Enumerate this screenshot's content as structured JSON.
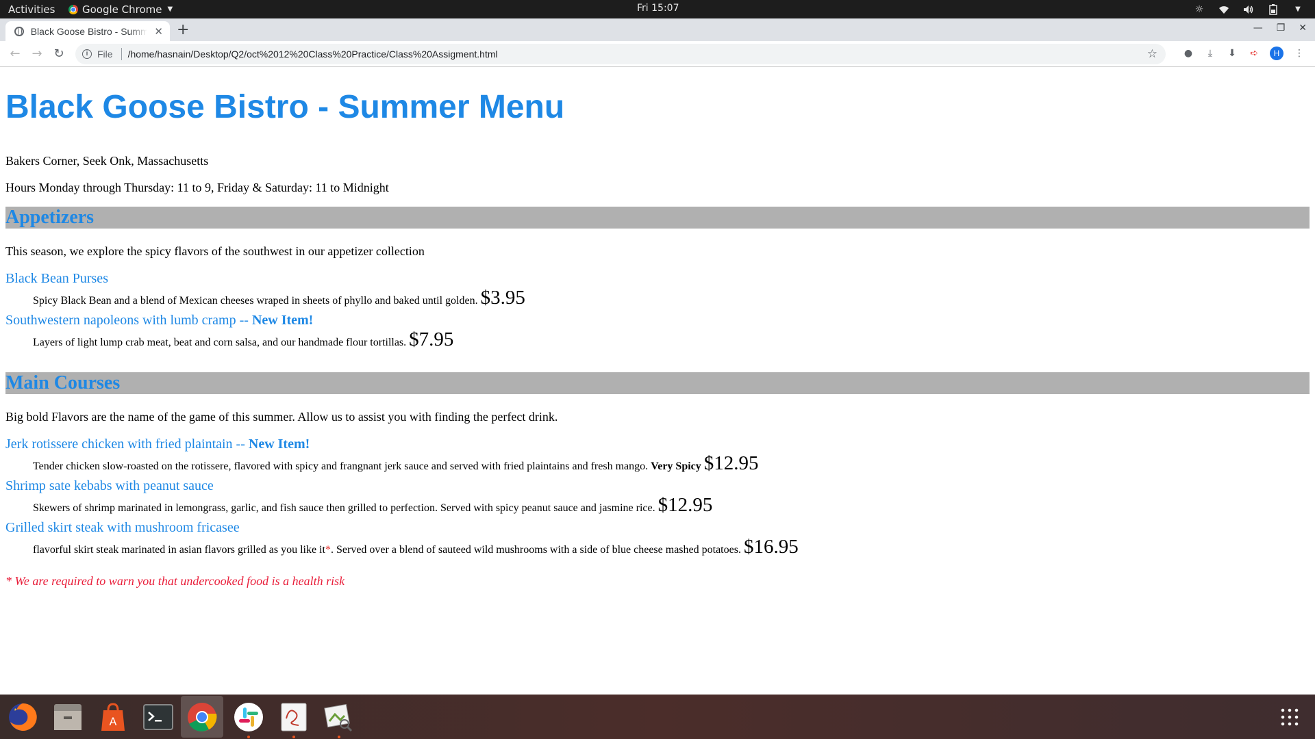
{
  "topbar": {
    "activities": "Activities",
    "app_name": "Google Chrome",
    "clock": "Fri 15:07"
  },
  "browser": {
    "tab_title": "Black Goose Bistro - Summer Menu",
    "url_scheme": "File",
    "url": "/home/hasnain/Desktop/Q2/oct%2012%20Class%20Practice/Class%20Assigment.html",
    "profile_initial": "H"
  },
  "page": {
    "title": "Black Goose Bistro - Summer Menu",
    "address": "Bakers Corner, Seek Onk, Massachusetts",
    "hours": "Hours Monday through Thursday: 11 to 9, Friday & Saturday: 11 to Midnight",
    "sections": [
      {
        "heading": "Appetizers",
        "intro": "This season, we explore the spicy flavors of the southwest in our appetizer collection",
        "items": [
          {
            "name": "Black Bean Purses",
            "new_tag": "",
            "description": "Spicy Black Bean and a blend of Mexican cheeses wraped in sheets of phyllo and baked until golden.",
            "spicy": "",
            "price": "$3.95"
          },
          {
            "name": "Southwestern napoleons with lumb cramp -- ",
            "new_tag": "New Item!",
            "description": "Layers of light lump crab meat, beat and corn salsa, and our handmade flour tortillas.",
            "spicy": "",
            "price": "$7.95"
          }
        ]
      },
      {
        "heading": "Main Courses",
        "intro": "Big bold Flavors are the name of the game of this summer. Allow us to assist you with finding the perfect drink.",
        "items": [
          {
            "name": "Jerk rotissere chicken with fried plaintain -- ",
            "new_tag": "New Item!",
            "description": "Tender chicken slow-roasted on the rotissere, flavored with spicy and frangnant jerk sauce and served with fried plaintains and fresh mango.",
            "spicy": "Very Spicy",
            "price": "$12.95"
          },
          {
            "name": "Shrimp sate kebabs with peanut sauce",
            "new_tag": "",
            "description": "Skewers of shrimp marinated in lemongrass, garlic, and fish sauce then grilled to perfection. Served with spicy peanut sauce and jasmine rice.",
            "spicy": "",
            "price": "$12.95"
          },
          {
            "name": "Grilled skirt steak with mushroom fricasee",
            "new_tag": "",
            "description_pre": "flavorful skirt steak marinated in asian flavors grilled as you like it",
            "asterisk": "*",
            "description_post": ". Served over a blend of sauteed wild mushrooms with a side of blue cheese mashed potatoes.",
            "price": "$16.95"
          }
        ]
      }
    ],
    "warning": "* We are required to warn you that undercooked food is a health risk"
  },
  "dock": {
    "apps": [
      "firefox-icon",
      "files-icon",
      "software-icon",
      "terminal-icon",
      "chrome-icon",
      "slack-icon",
      "text-editor-icon",
      "image-viewer-icon"
    ]
  },
  "colors": {
    "heading_blue": "#1e88e5",
    "section_bar": "#b0b0b0",
    "warning_red": "#e91e3a"
  }
}
